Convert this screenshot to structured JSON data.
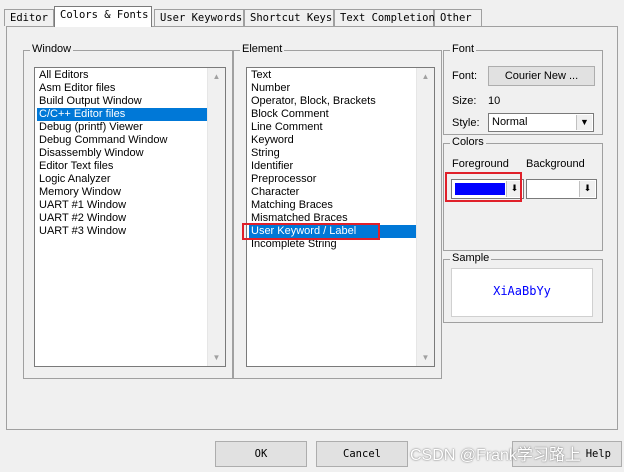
{
  "tabs": [
    "Editor",
    "Colors & Fonts",
    "User Keywords",
    "Shortcut Keys",
    "Text Completion",
    "Other"
  ],
  "active_tab": 1,
  "window_panel": {
    "title": "Window",
    "items": [
      "All Editors",
      "Asm Editor files",
      "Build Output Window",
      "C/C++ Editor files",
      "Debug (printf) Viewer",
      "Debug Command Window",
      "Disassembly Window",
      "Editor Text files",
      "Logic Analyzer",
      "Memory Window",
      "UART #1 Window",
      "UART #2 Window",
      "UART #3 Window"
    ],
    "selected": 3
  },
  "element_panel": {
    "title": "Element",
    "items": [
      "Text",
      "Number",
      "Operator, Block, Brackets",
      "Block Comment",
      "Line Comment",
      "Keyword",
      "String",
      "Identifier",
      "Preprocessor",
      "Character",
      "Matching Braces",
      "Mismatched Braces",
      "User Keyword / Label",
      "Incomplete String"
    ],
    "selected": 12
  },
  "font_panel": {
    "title": "Font",
    "font_label": "Font:",
    "font_button": "Courier New ...",
    "size_label": "Size:",
    "size_value": "10",
    "style_label": "Style:",
    "style_value": "Normal"
  },
  "colors_panel": {
    "title": "Colors",
    "foreground_label": "Foreground",
    "background_label": "Background",
    "foreground_color": "#0000ff",
    "background_color": "#ffffff"
  },
  "sample_panel": {
    "title": "Sample",
    "text": "XiAaBbYy",
    "text_color": "#0000ff"
  },
  "buttons": {
    "ok": "OK",
    "cancel": "Cancel",
    "help": "Help"
  },
  "watermark": "CSDN @Frank学习路上"
}
